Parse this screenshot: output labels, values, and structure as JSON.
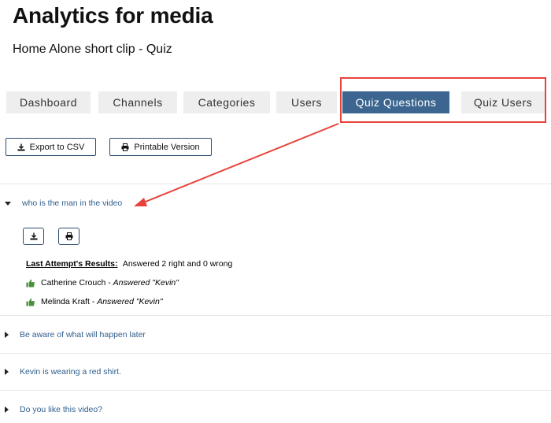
{
  "header": {
    "title": "Analytics for media",
    "subtitle": "Home Alone short clip - Quiz"
  },
  "tabs": [
    {
      "label": "Dashboard"
    },
    {
      "label": "Channels"
    },
    {
      "label": "Categories"
    },
    {
      "label": "Users"
    },
    {
      "label": "Quiz Questions",
      "active": true
    },
    {
      "label": "Quiz Users"
    }
  ],
  "toolbar": {
    "export_label": "Export to CSV",
    "print_label": "Printable Version"
  },
  "questions": [
    {
      "text": "who is the man in the video",
      "expanded": true,
      "results_label": "Last Attempt's Results:",
      "results_text": "Answered 2 right and 0 wrong",
      "answers": [
        {
          "user": "Catherine Crouch",
          "separator": " - ",
          "answer": "Answered \"Kevin\""
        },
        {
          "user": "Melinda Kraft",
          "separator": " - ",
          "answer": "Answered \"Kevin\""
        }
      ]
    },
    {
      "text": "Be aware of what will happen later",
      "expanded": false
    },
    {
      "text": "Kevin is wearing a red shirt.",
      "expanded": false
    },
    {
      "text": "Do you like this video?",
      "expanded": false
    }
  ],
  "colors": {
    "accent": "#3c6690",
    "link": "#2e5e8c",
    "annotation": "#e8433a",
    "thumb": "#4a8f3c"
  },
  "icons": {
    "export": "download-icon",
    "print": "printer-icon",
    "correct": "thumbs-up-icon"
  }
}
